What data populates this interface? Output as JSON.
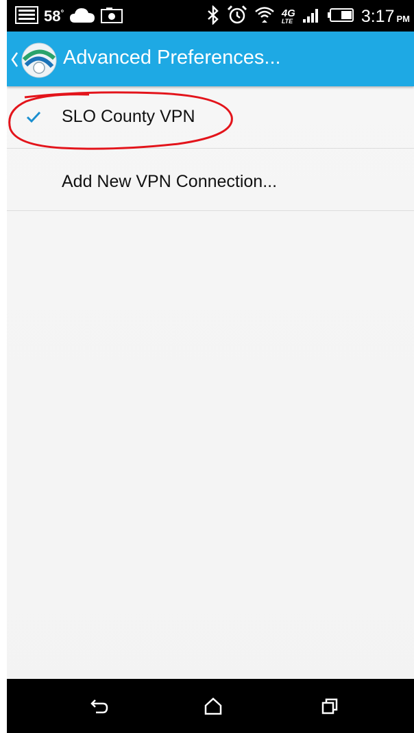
{
  "status_bar": {
    "temperature": "58",
    "degree": "°",
    "network_top": "4G",
    "network_bottom": "LTE",
    "time": "3:17",
    "ampm": "PM",
    "battery_level": 0.5
  },
  "action_bar": {
    "title": "Advanced Preferences..."
  },
  "list": {
    "items": [
      {
        "label": "SLO County VPN",
        "checked": true
      },
      {
        "label": "Add New VPN Connection..."
      }
    ]
  },
  "colors": {
    "action_bar": "#1ea9e4",
    "check": "#1a8fd0",
    "annotation": "#e3141b"
  },
  "icons": {
    "status_left": [
      "message-icon",
      "cloud-icon",
      "camera-icon"
    ],
    "status_right": [
      "bluetooth-icon",
      "alarm-icon",
      "wifi-icon",
      "signal-icon",
      "battery-icon"
    ],
    "nav": [
      "back-icon",
      "home-icon",
      "recents-icon"
    ],
    "app": "anyconnect-logo-icon"
  }
}
